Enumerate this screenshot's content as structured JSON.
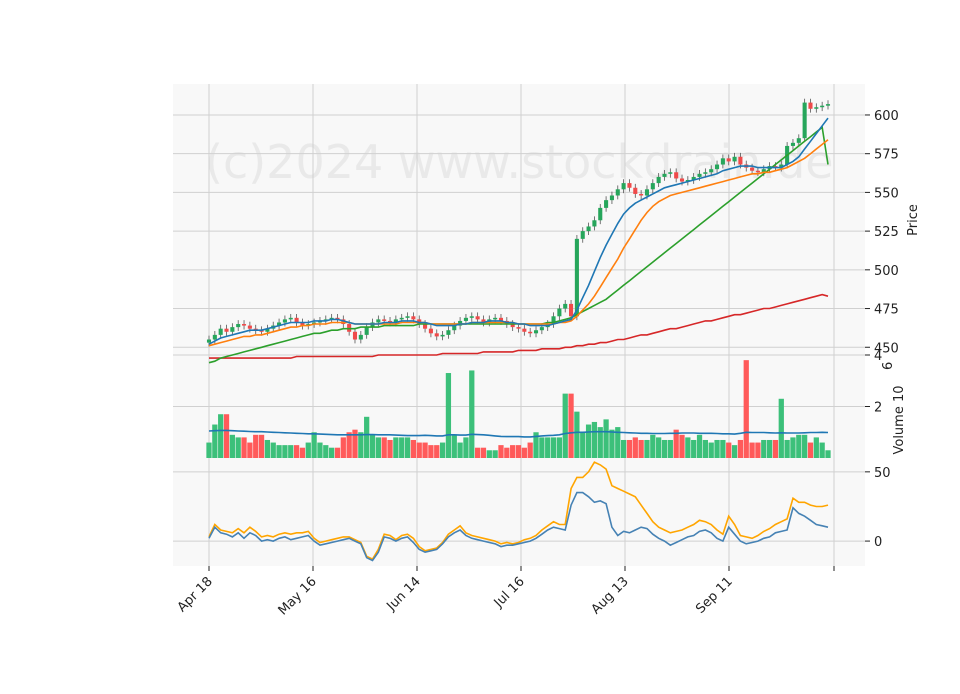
{
  "chart_data": {
    "type": "candlestick",
    "watermark": "(c)2024 www.stockdrain.de",
    "x_tick_labels": [
      "Apr 18",
      "May 16",
      "Jun 14",
      "Jul 16",
      "Aug 13",
      "Sep 11"
    ],
    "price_panel": {
      "ylabel": "Price",
      "ylim": [
        445,
        620
      ],
      "yticks": [
        450,
        475,
        500,
        525,
        550,
        575,
        600
      ],
      "series_colors": {
        "ma_fast": "#1f77b4",
        "ma_mid": "#ff7f0e",
        "ma_slow": "#2ca02c",
        "ma_long": "#d62728"
      },
      "up_color": "#26a65b",
      "down_color": "#f04a4a",
      "closes": [
        455,
        458,
        462,
        460,
        463,
        465,
        464,
        462,
        461,
        460,
        462,
        464,
        466,
        468,
        469,
        466,
        464,
        465,
        466,
        467,
        468,
        469,
        468,
        465,
        460,
        455,
        458,
        463,
        466,
        468,
        467,
        466,
        468,
        469,
        470,
        468,
        465,
        462,
        459,
        457,
        458,
        461,
        464,
        467,
        469,
        470,
        468,
        466,
        468,
        469,
        467,
        465,
        463,
        462,
        460,
        459,
        461,
        463,
        465,
        470,
        475,
        478,
        470,
        520,
        525,
        528,
        532,
        540,
        545,
        548,
        552,
        556,
        553,
        549,
        548,
        552,
        556,
        560,
        562,
        563,
        559,
        557,
        558,
        560,
        562,
        563,
        565,
        568,
        572,
        570,
        573,
        568,
        566,
        564,
        563,
        565,
        567,
        566,
        568,
        580,
        582,
        585,
        608,
        604,
        605,
        606,
        607
      ],
      "ma_fast": [
        452,
        454,
        456,
        457,
        458,
        459,
        460,
        461,
        461,
        461,
        462,
        463,
        464,
        465,
        466,
        466,
        466,
        466,
        467,
        467,
        467,
        468,
        468,
        467,
        466,
        465,
        465,
        465,
        465,
        465,
        466,
        466,
        466,
        467,
        467,
        467,
        466,
        466,
        465,
        464,
        464,
        464,
        464,
        465,
        465,
        466,
        466,
        466,
        467,
        467,
        467,
        466,
        466,
        465,
        465,
        464,
        464,
        464,
        464,
        465,
        466,
        467,
        468,
        474,
        482,
        490,
        499,
        508,
        516,
        523,
        530,
        536,
        540,
        543,
        545,
        547,
        549,
        551,
        553,
        554,
        555,
        556,
        557,
        558,
        559,
        560,
        561,
        562,
        564,
        565,
        566,
        567,
        567,
        567,
        566,
        566,
        566,
        566,
        566,
        568,
        570,
        573,
        578,
        583,
        588,
        593,
        598
      ],
      "ma_mid": [
        451,
        452,
        453,
        454,
        455,
        456,
        457,
        457,
        458,
        458,
        459,
        460,
        461,
        462,
        463,
        463,
        464,
        464,
        465,
        465,
        465,
        466,
        466,
        466,
        466,
        465,
        465,
        465,
        465,
        465,
        465,
        465,
        465,
        466,
        466,
        466,
        466,
        466,
        465,
        465,
        465,
        465,
        465,
        465,
        465,
        466,
        466,
        466,
        466,
        466,
        466,
        466,
        466,
        465,
        465,
        465,
        465,
        465,
        465,
        465,
        466,
        466,
        467,
        470,
        474,
        478,
        483,
        489,
        495,
        501,
        507,
        514,
        520,
        526,
        532,
        537,
        541,
        544,
        546,
        548,
        549,
        550,
        551,
        552,
        553,
        554,
        555,
        556,
        557,
        558,
        559,
        560,
        561,
        562,
        562,
        563,
        563,
        564,
        565,
        566,
        568,
        570,
        572,
        575,
        578,
        581,
        584
      ],
      "ma_slow": [
        440,
        441,
        443,
        444,
        445,
        446,
        447,
        448,
        449,
        450,
        451,
        452,
        453,
        454,
        455,
        456,
        457,
        458,
        459,
        459,
        460,
        461,
        461,
        462,
        462,
        462,
        463,
        463,
        463,
        463,
        464,
        464,
        464,
        464,
        464,
        464,
        465,
        465,
        465,
        465,
        465,
        465,
        465,
        465,
        465,
        465,
        465,
        465,
        465,
        465,
        465,
        465,
        465,
        465,
        465,
        465,
        465,
        465,
        466,
        466,
        467,
        468,
        469,
        471,
        473,
        475,
        477,
        479,
        481,
        484,
        487,
        490,
        493,
        496,
        499,
        502,
        505,
        508,
        511,
        514,
        517,
        520,
        523,
        526,
        529,
        532,
        535,
        538,
        541,
        544,
        547,
        550,
        553,
        556,
        559,
        562,
        565,
        568,
        571,
        574,
        577,
        580,
        583,
        586,
        589,
        592,
        568
      ],
      "ma_long": [
        443,
        443,
        443,
        443,
        443,
        443,
        443,
        443,
        443,
        443,
        443,
        443,
        443,
        443,
        443,
        444,
        444,
        444,
        444,
        444,
        444,
        444,
        444,
        444,
        444,
        444,
        444,
        444,
        444,
        445,
        445,
        445,
        445,
        445,
        445,
        445,
        445,
        445,
        445,
        445,
        446,
        446,
        446,
        446,
        446,
        446,
        446,
        447,
        447,
        447,
        447,
        447,
        447,
        448,
        448,
        448,
        448,
        449,
        449,
        449,
        449,
        450,
        450,
        451,
        451,
        452,
        452,
        453,
        453,
        454,
        455,
        455,
        456,
        457,
        458,
        458,
        459,
        460,
        461,
        462,
        462,
        463,
        464,
        465,
        466,
        467,
        467,
        468,
        469,
        470,
        471,
        471,
        472,
        473,
        474,
        475,
        475,
        476,
        477,
        478,
        479,
        480,
        481,
        482,
        483,
        484,
        483
      ]
    },
    "volume_panel": {
      "ylabel": "Volume",
      "scale_label": "10",
      "scale_exponent": "6",
      "ylim": [
        0,
        4
      ],
      "yticks": [
        2,
        4
      ],
      "avg_line_color": "#1f77b4",
      "values": [
        0.6,
        1.3,
        1.7,
        1.7,
        0.9,
        0.8,
        0.8,
        0.6,
        0.9,
        0.9,
        0.7,
        0.6,
        0.5,
        0.5,
        0.5,
        0.5,
        0.4,
        0.6,
        1.0,
        0.6,
        0.5,
        0.4,
        0.4,
        0.8,
        1.0,
        1.1,
        1.0,
        1.6,
        0.9,
        0.8,
        0.8,
        0.7,
        0.8,
        0.8,
        0.8,
        0.7,
        0.6,
        0.6,
        0.5,
        0.5,
        0.6,
        3.3,
        0.9,
        0.6,
        0.8,
        3.4,
        0.4,
        0.4,
        0.3,
        0.3,
        0.5,
        0.4,
        0.5,
        0.5,
        0.4,
        0.6,
        1.0,
        0.8,
        0.8,
        0.8,
        0.8,
        2.5,
        2.5,
        1.8,
        1.0,
        1.3,
        1.4,
        1.2,
        1.5,
        1.1,
        1.2,
        0.7,
        0.7,
        0.8,
        0.7,
        0.7,
        0.9,
        0.8,
        0.7,
        0.7,
        1.1,
        0.9,
        0.8,
        0.7,
        0.9,
        0.7,
        0.6,
        0.7,
        0.7,
        0.6,
        0.5,
        0.7,
        3.8,
        0.6,
        0.6,
        0.7,
        0.7,
        0.7,
        2.3,
        0.7,
        0.8,
        0.9,
        0.9,
        0.6,
        0.8,
        0.6,
        0.3
      ],
      "avg": [
        1.05,
        1.06,
        1.07,
        1.07,
        1.06,
        1.05,
        1.04,
        1.03,
        1.02,
        1.02,
        1.01,
        1.0,
        0.99,
        0.98,
        0.97,
        0.96,
        0.95,
        0.94,
        0.94,
        0.93,
        0.92,
        0.91,
        0.9,
        0.9,
        0.9,
        0.9,
        0.9,
        0.91,
        0.91,
        0.9,
        0.9,
        0.9,
        0.89,
        0.88,
        0.87,
        0.87,
        0.87,
        0.88,
        0.87,
        0.86,
        0.86,
        0.9,
        0.9,
        0.89,
        0.89,
        0.92,
        0.91,
        0.9,
        0.88,
        0.86,
        0.84,
        0.83,
        0.83,
        0.83,
        0.82,
        0.82,
        0.84,
        0.86,
        0.87,
        0.88,
        0.9,
        0.95,
        0.98,
        1.0,
        1.0,
        1.01,
        1.02,
        1.02,
        1.02,
        1.01,
        1.0,
        0.99,
        0.98,
        0.97,
        0.96,
        0.96,
        0.95,
        0.95,
        0.95,
        0.96,
        0.96,
        0.97,
        0.97,
        0.97,
        0.96,
        0.96,
        0.96,
        0.95,
        0.94,
        0.94,
        0.93,
        0.96,
        1.0,
        0.99,
        0.99,
        0.99,
        0.98,
        0.97,
        0.98,
        0.97,
        0.97,
        0.97,
        0.98,
        0.99,
        0.99,
        1.0,
        0.99
      ]
    },
    "oscillator_panel": {
      "ylim": [
        -18,
        60
      ],
      "yticks": [
        0,
        50
      ],
      "line1_color": "#4682b4",
      "line2_color": "#ffa500",
      "line1": [
        2,
        10,
        6,
        5,
        3,
        6,
        2,
        6,
        4,
        0,
        1,
        0,
        2,
        3,
        1,
        2,
        3,
        4,
        0,
        -3,
        -2,
        -1,
        0,
        1,
        2,
        0,
        -2,
        -12,
        -14,
        -8,
        3,
        2,
        0,
        2,
        3,
        -1,
        -6,
        -8,
        -7,
        -6,
        -2,
        3,
        6,
        8,
        4,
        2,
        1,
        0,
        -1,
        -2,
        -4,
        -3,
        -3,
        -2,
        -1,
        0,
        2,
        5,
        8,
        10,
        9,
        8,
        26,
        35,
        35,
        32,
        28,
        29,
        27,
        10,
        4,
        7,
        6,
        8,
        10,
        9,
        5,
        2,
        0,
        -3,
        -1,
        1,
        3,
        4,
        7,
        8,
        6,
        2,
        0,
        10,
        5,
        0,
        -2,
        -1,
        0,
        2,
        3,
        6,
        7,
        8,
        24,
        20,
        18,
        15,
        12,
        11,
        10
      ],
      "line2": [
        3,
        12,
        8,
        7,
        6,
        9,
        6,
        10,
        7,
        3,
        4,
        3,
        5,
        6,
        5,
        6,
        6,
        7,
        2,
        -1,
        0,
        1,
        2,
        3,
        3,
        1,
        -1,
        -11,
        -13,
        -6,
        5,
        4,
        1,
        4,
        5,
        2,
        -4,
        -7,
        -6,
        -5,
        -1,
        5,
        8,
        11,
        6,
        4,
        3,
        2,
        1,
        0,
        -2,
        -1,
        -2,
        -1,
        1,
        2,
        4,
        8,
        11,
        14,
        12,
        12,
        38,
        46,
        46,
        50,
        57,
        55,
        52,
        40,
        38,
        36,
        34,
        32,
        26,
        20,
        14,
        10,
        8,
        6,
        7,
        8,
        10,
        12,
        15,
        14,
        12,
        8,
        5,
        18,
        12,
        4,
        3,
        2,
        4,
        7,
        9,
        12,
        14,
        16,
        31,
        28,
        28,
        26,
        25,
        25,
        26
      ]
    }
  }
}
